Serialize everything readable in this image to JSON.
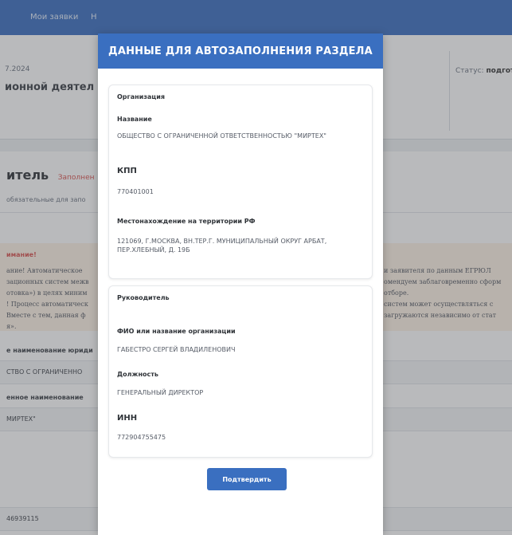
{
  "nav": {
    "item1": "Мои заявки",
    "item2": "Н"
  },
  "info": {
    "date": "7.2024",
    "activity": "ионной деятел",
    "status_label": "Статус:",
    "status_value": "подгот"
  },
  "applicant": {
    "title": "итель",
    "fill_link": "Заполнен",
    "required_text": "обязательные для запо",
    "attention_title": "имание!",
    "attention_lines": [
      "ание! Автоматическое",
      "зационных систем межв",
      "отовка») в целях миним",
      "! Процесс автоматическ",
      "Вместе с тем, данная ф",
      "я»."
    ],
    "attention_right_lines": [
      "и заявителя по данным ЕГРЮЛ",
      "омендуем заблаговременно сформ",
      "отборе.",
      "систем может осуществляться с",
      "загружаются независимо от стат"
    ],
    "full_name_label": "е наименование юриди",
    "full_name_value": "СТВО С ОГРАНИЧЕННО",
    "short_name_label": "енное наименование",
    "short_name_value": "МИРТЕХ\"",
    "number_value": "46939115"
  },
  "modal": {
    "title": "ДАННЫЕ ДЛЯ АВТОЗАПОЛНЕНИЯ РАЗДЕЛА",
    "organization": {
      "section_title": "Организация",
      "name_label": "Название",
      "name_value": "ОБЩЕСТВО С ОГРАНИЧЕННОЙ ОТВЕТСТВЕННОСТЬЮ \"МИРТЕХ\"",
      "kpp_label": "КПП",
      "kpp_value": "770401001",
      "location_label": "Местонахождение на территории РФ",
      "location_value": "121069, Г.МОСКВА, ВН.ТЕР.Г. МУНИЦИПАЛЬНЫЙ ОКРУГ АРБАТ, ПЕР.ХЛЕБНЫЙ, Д. 19Б"
    },
    "head": {
      "section_title": "Руководитель",
      "fio_label": "ФИО или название организации",
      "fio_value": "ГАБЕСТРО СЕРГЕЙ ВЛАДИЛЕНОВИЧ",
      "position_label": "Должность",
      "position_value": "ГЕНЕРАЛЬНЫЙ ДИРЕКТОР",
      "inn_label": "ИНН",
      "inn_value": "772904755475"
    },
    "confirm_label": "Подтвердить"
  }
}
